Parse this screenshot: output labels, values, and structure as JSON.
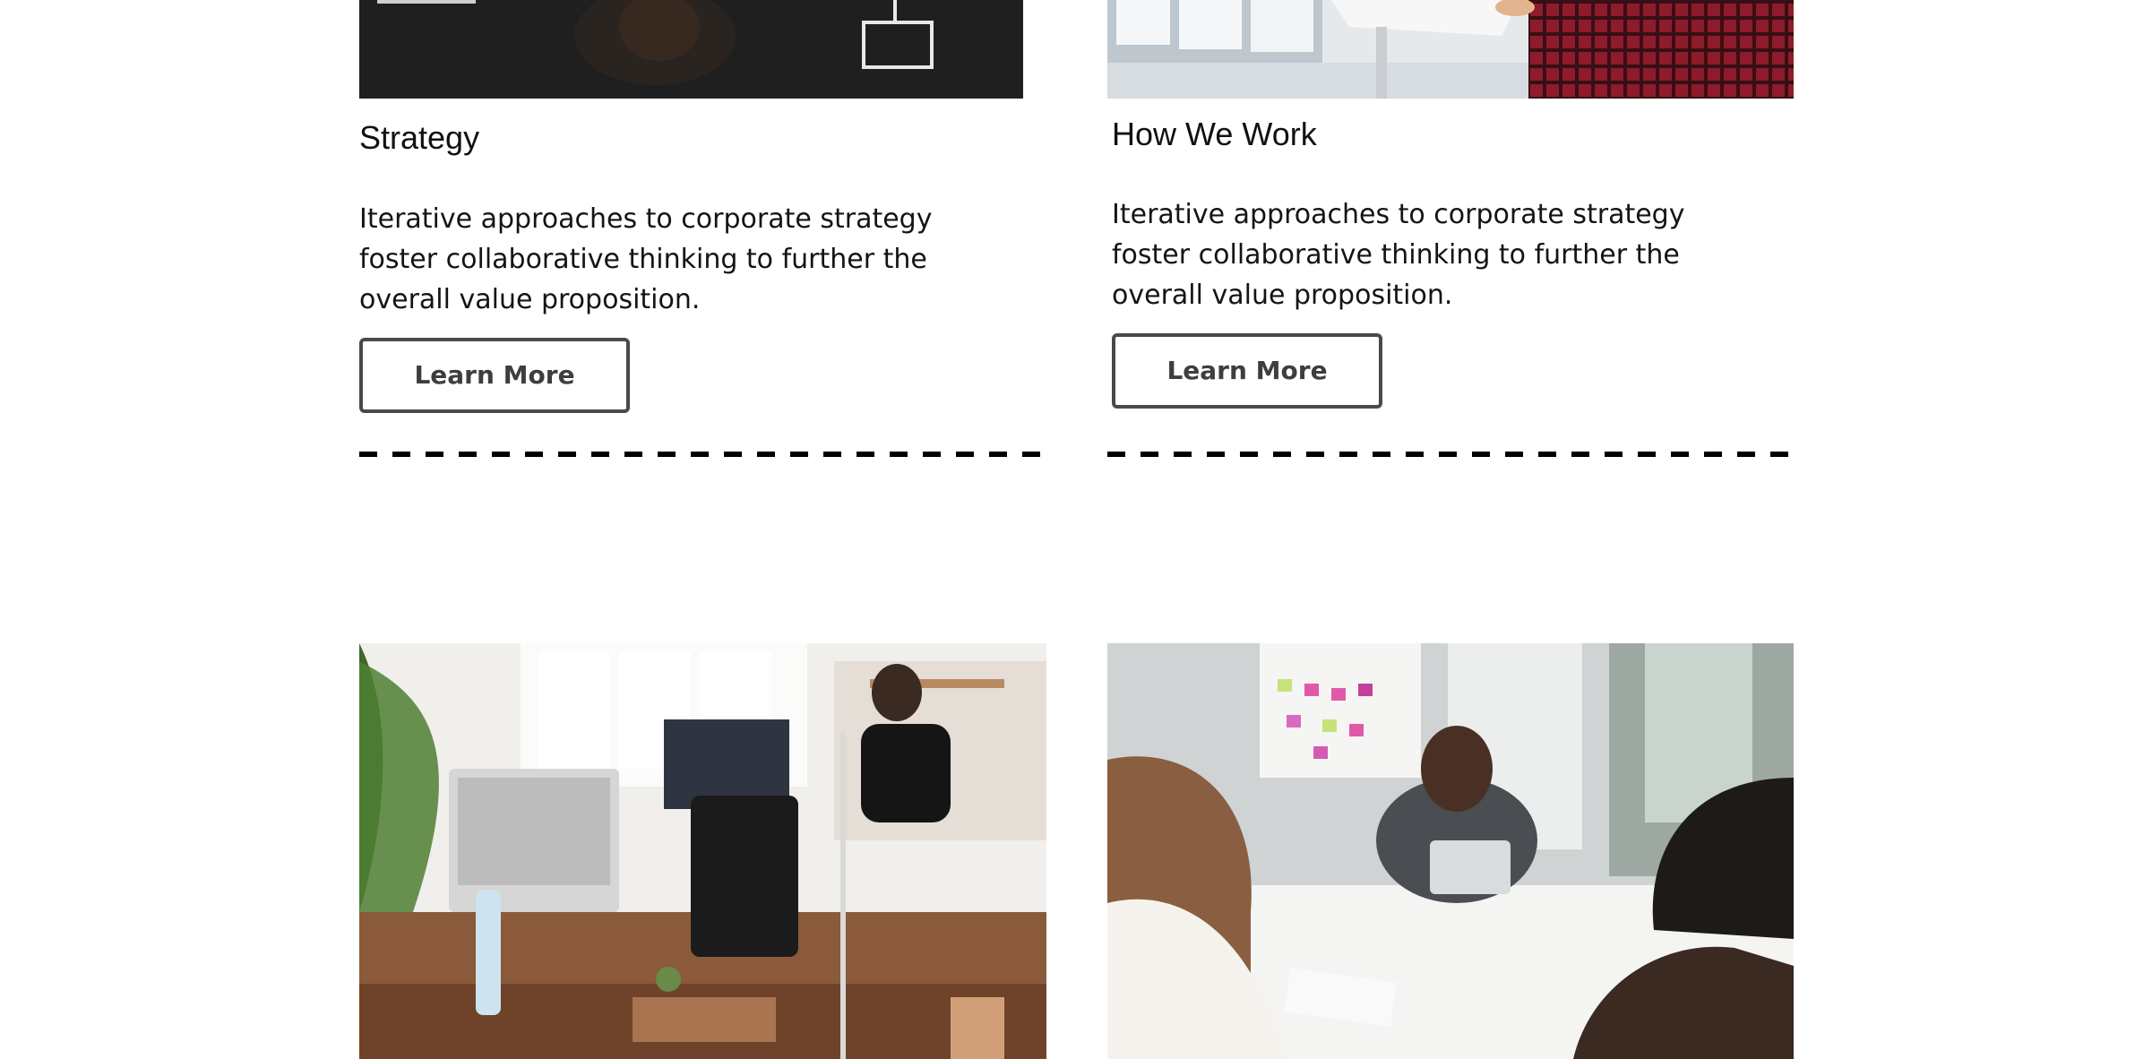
{
  "cards": [
    {
      "title": "Strategy",
      "description": "Iterative approaches to corporate strategy foster collaborative thinking to further the overall value proposition.",
      "button_label": "Learn More"
    },
    {
      "title": "How We Work",
      "description": "Iterative approaches to corporate strategy foster collaborative thinking to further the overall value proposition.",
      "button_label": "Learn More"
    }
  ],
  "images": {
    "top_left": "strategy-chalkboard-photo",
    "top_right": "presentation-whiteboard-photo",
    "bottom_left": "office-desks-photo",
    "bottom_right": "team-meeting-photo"
  }
}
